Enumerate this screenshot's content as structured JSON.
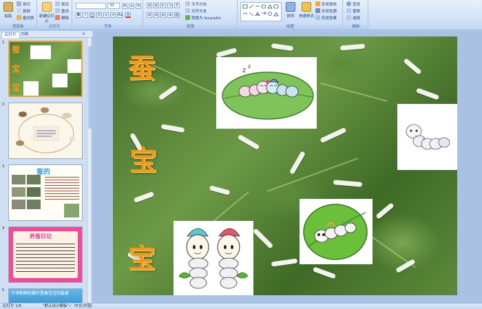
{
  "ribbon": {
    "clipboard": {
      "label": "剪贴板",
      "paste": "粘贴",
      "cut": "剪切",
      "copy": "复制",
      "format_painter": "格式刷"
    },
    "slides": {
      "label": "幻灯片",
      "new_slide": "新建幻灯片",
      "layout": "版式",
      "reset": "重设",
      "delete": "删除"
    },
    "font": {
      "label": "字体",
      "font_size": "32"
    },
    "paragraph": {
      "label": "段落",
      "text_direction": "文字方向",
      "align_text": "对齐文本",
      "smartart": "转换为 SmartArt"
    },
    "drawing": {
      "label": "绘图",
      "arrange": "排列",
      "quick_styles": "快速样式",
      "shape_fill": "形状填充",
      "shape_outline": "形状轮廓",
      "shape_effects": "形状效果"
    },
    "editing": {
      "label": "编辑",
      "find": "查找",
      "replace": "替换",
      "select": "选择"
    }
  },
  "pane": {
    "tab_slides": "幻灯片",
    "tab_outline": "大纲",
    "close": "×",
    "thumbs": [
      {
        "num": "1"
      },
      {
        "num": "2"
      },
      {
        "num": "3",
        "title": "蚕的"
      },
      {
        "num": "4",
        "title": "养蚕日记"
      },
      {
        "num": "5",
        "caption": "干净新鲜的桑叶是蚕宝宝的最爱"
      }
    ]
  },
  "slide": {
    "title_chars": [
      "蚕",
      "宝",
      "宝"
    ]
  },
  "status": {
    "slide_index": "幻灯片 1/8",
    "theme": "\"默认设计模板\"",
    "language": "中文(中国)"
  },
  "colors": {
    "title_orange": "#f19a1a",
    "ribbon_bg": "#d2e3f7",
    "selected_border": "#f3a33a"
  }
}
